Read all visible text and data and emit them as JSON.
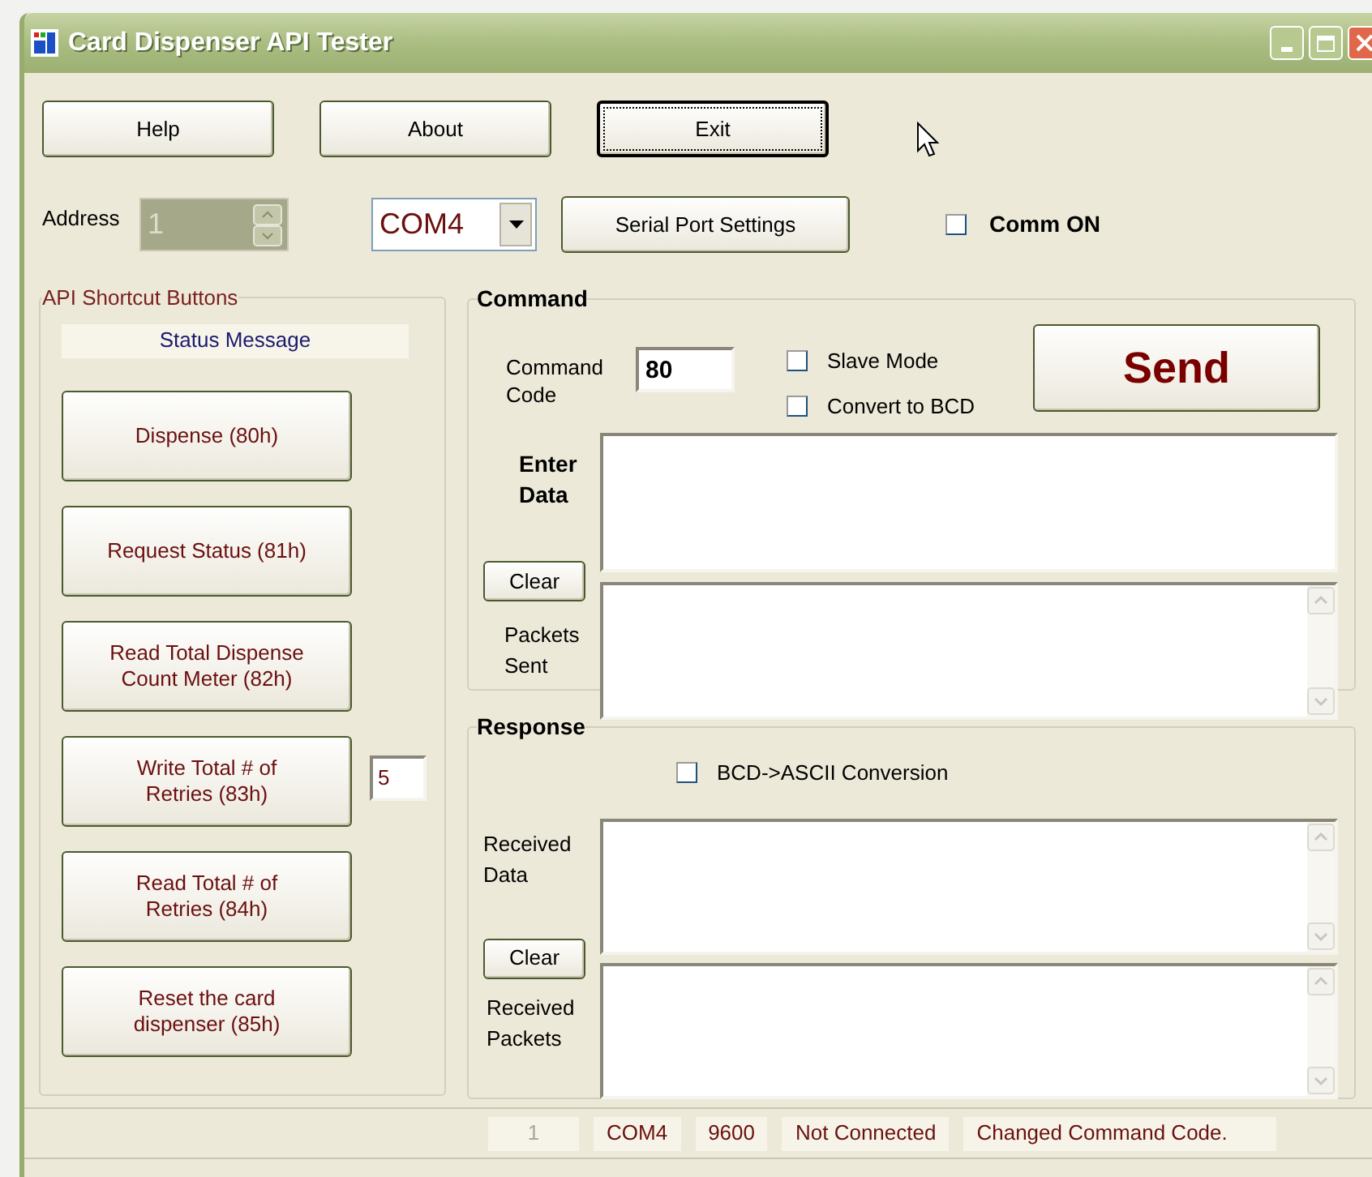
{
  "window": {
    "title": "Card Dispenser API Tester"
  },
  "toolbar_buttons": [
    {
      "label": "Help",
      "focused": false
    },
    {
      "label": "About",
      "focused": false
    },
    {
      "label": "Exit",
      "focused": true
    }
  ],
  "address": {
    "label": "Address",
    "value": "1",
    "disabled": true
  },
  "port_select": {
    "value": "COM4"
  },
  "serial_settings_button": {
    "label": "Serial Port Settings"
  },
  "comm_on": {
    "label": "Comm ON",
    "checked": false
  },
  "shortcuts": {
    "title": "API Shortcut Buttons",
    "status_message": "Status Message",
    "buttons": [
      {
        "kind": "button",
        "label": "Dispense (80h)"
      },
      {
        "kind": "button",
        "label": "Request Status (81h)"
      },
      {
        "kind": "button",
        "label": "Read Total Dispense\nCount Meter (82h)"
      },
      {
        "kind": "button_with_field",
        "label": "Write Total # of\nRetries (83h)",
        "value": "5"
      },
      {
        "kind": "button",
        "label": "Read Total # of\nRetries (84h)"
      },
      {
        "kind": "button",
        "label": "Reset the card\ndispenser (85h)"
      }
    ]
  },
  "command": {
    "title": "Command",
    "code_label": "Command\nCode",
    "code_value": "80",
    "options": [
      {
        "label": "Slave Mode",
        "checked": false
      },
      {
        "label": "Convert to BCD",
        "checked": false
      }
    ],
    "send_button": "Send",
    "enter_data_label": "Enter\nData",
    "clear_button": "Clear",
    "packets_sent_label": "Packets\nSent"
  },
  "response": {
    "title": "Response",
    "conversion": {
      "label": "BCD->ASCII Conversion",
      "checked": false
    },
    "received_data_label": "Received\nData",
    "clear_button": "Clear",
    "received_packets_label": "Received\nPackets"
  },
  "status_bar": [
    {
      "text": "1",
      "disabled": true
    },
    {
      "text": "COM4",
      "disabled": false
    },
    {
      "text": "9600",
      "disabled": false
    },
    {
      "text": "Not Connected",
      "disabled": false
    },
    {
      "text": "Changed Command Code.",
      "disabled": false
    }
  ]
}
